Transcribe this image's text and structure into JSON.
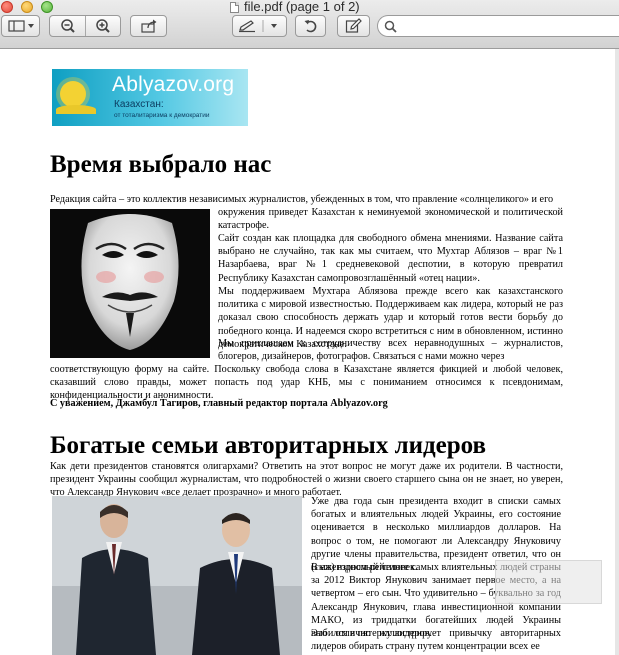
{
  "window": {
    "title": "file.pdf (page 1 of 2)"
  },
  "toolbar": {
    "search_placeholder": ""
  },
  "banner": {
    "brand": "Ablyazov.org",
    "region": "Казахстан:",
    "tagline": "от тоталитаризма к демократии"
  },
  "article1": {
    "heading": "Время выбрало нас",
    "intro_line": "Редакция сайта – это коллектив независимых журналистов, убежденных в том, что правление «солнцеликого» и его",
    "side_p1": "окружения приведет Казахстан к неминуемой экономической и политической катастрофе.",
    "side_p2": "Сайт создан как площадка для свободного обмена мнениями. Название сайта выбрано не случайно, так как мы считаем, что Мухтар Аблязов – враг №1 Назарбаева, враг №1 средневековой деспотии, в которую превратил Республику Казахстан самопровозглашённый «отец нации».",
    "side_p3": "Мы поддерживаем Мухтара Аблязова прежде всего как казахстанского политика с мировой известностью. Поддерживаем как лидера, который не раз доказал свою способность держать удар и который готов вести борьбу до победного конца. И надеемся скоро встретиться с ним в обновленном, истинно демократическом Казахстане.",
    "side_p4_start": "Мы приглашаем к сотрудничеству всех неравнодушных – журналистов, блогеров, дизайнеров, фотографов. Связаться с нами можно через",
    "full_p4_end": "соответствующую форму на сайте. Поскольку свобода слова в Казахстане является фикцией и любой человек, сказавший слово правды, может попасть под удар КНБ, мы с пониманием относимся к псевдонимам, конфиденциальности и анонимности.",
    "signature": "С уважением, Джамбул Тагиров, главный редактор портала Ablyazov.org"
  },
  "article2": {
    "heading": "Богатые семьи авторитарных лидеров",
    "intro": "Как дети президентов становятся олигархами? Ответить на этот вопрос не могут даже их родители. В частности, президент Украины сообщил журналистам, что подробностей о жизни своего старшего сына он не знает, но уверен, что Александр Янукович «все делает прозрачно» и много работает.",
    "side_p1": "Уже два года сын президента входит в списки самых богатых и влиятельных людей Украины, его состояние оценивается в несколько миллиардов долларов. На вопрос о том, не помогают ли Александру Януковичу другие члены правительства, президент ответил, что он (сын) взрослый человек.",
    "side_p2": "В ежегодном рейтинге самых влиятельных людей страны за 2012 Виктор Янукович занимает первое место, а на четвертом – его сын. Что удивительно – буквально за год Александр Янукович, глава инвестиционной компании МАКО, из тридцатки богатейших людей Украины выбился в пятерку лидеров.",
    "side_p3": "Это отлично иллюстрирует привычку авторитарных лидеров обирать страну путем концентрации всех ее"
  }
}
